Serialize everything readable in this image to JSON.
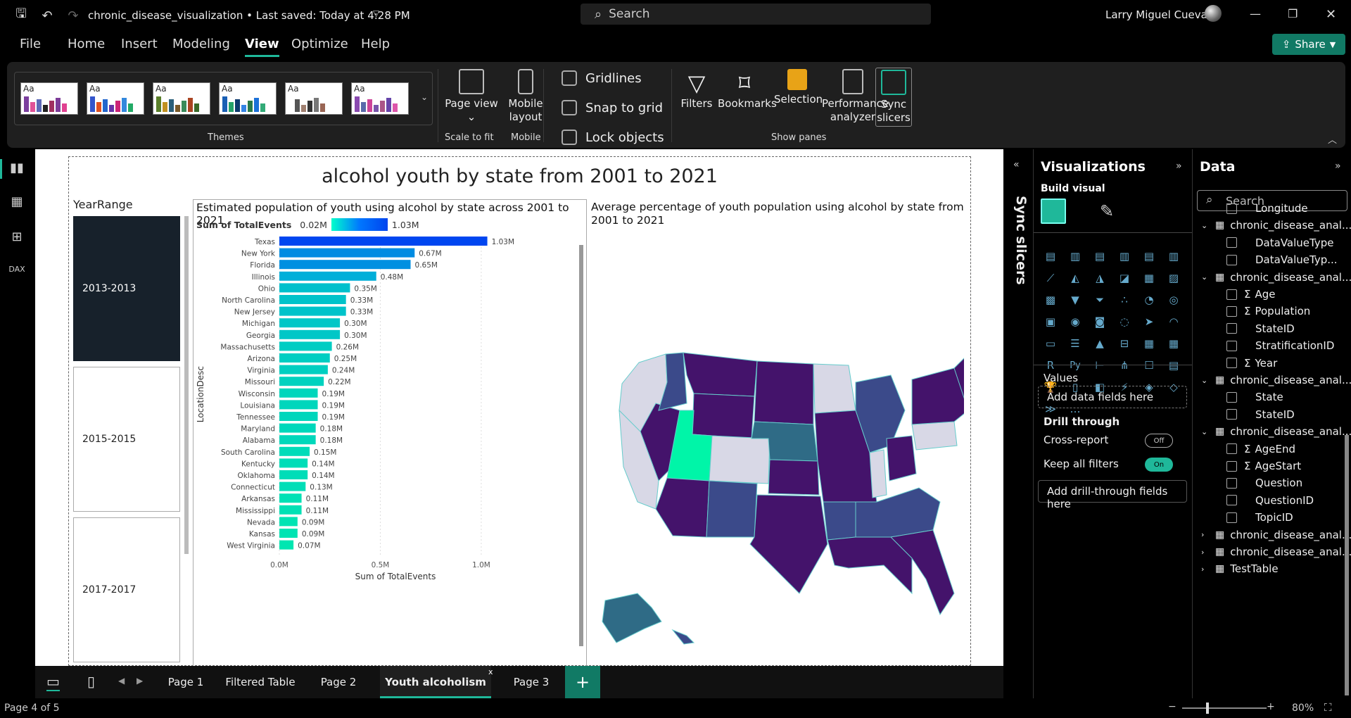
{
  "titlebar": {
    "doc_title": "chronic_disease_visualization • Last saved: Today at 4:28 PM",
    "search_placeholder": "Search",
    "user": "Larry Miguel Cueva"
  },
  "menu": [
    "File",
    "Home",
    "Insert",
    "Modeling",
    "View",
    "Optimize",
    "Help"
  ],
  "share_label": "Share",
  "ribbon": {
    "themes_label": "Themes",
    "page_view": "Page view",
    "scale_to_fit": "Scale to fit",
    "mobile_layout": "Mobile layout",
    "mobile": "Mobile",
    "gridlines": "Gridlines",
    "snap_to_grid": "Snap to grid",
    "lock_objects": "Lock objects",
    "filters": "Filters",
    "bookmarks": "Bookmarks",
    "selection": "Selection",
    "performance_analyzer": "Performance analyzer",
    "sync_slicers": "Sync slicers",
    "show_panes": "Show panes",
    "theme_aa": "Aa"
  },
  "report": {
    "title": "alcohol youth by state from 2001 to 2021",
    "slicer_title": "YearRange",
    "slicer_items": [
      "2013-2013",
      "2015-2015",
      "2017-2017"
    ],
    "bar_title": "Estimated population of youth using alcohol by state across 2001 to 2021",
    "legend_label": "Sum of TotalEvents",
    "legend_min": "0.02M",
    "legend_max": "1.03M",
    "y_axis_label": "LocationDesc",
    "x_axis_label": "Sum of TotalEvents",
    "map_title": "Average percentage of youth population using alcohol by state from 2001 to 2021"
  },
  "chart_data": {
    "type": "bar",
    "orientation": "horizontal",
    "categories": [
      "Texas",
      "New York",
      "Florida",
      "Illinois",
      "Ohio",
      "North Carolina",
      "New Jersey",
      "Michigan",
      "Georgia",
      "Massachusetts",
      "Arizona",
      "Virginia",
      "Missouri",
      "Wisconsin",
      "Louisiana",
      "Tennessee",
      "Maryland",
      "Alabama",
      "South Carolina",
      "Kentucky",
      "Oklahoma",
      "Connecticut",
      "Arkansas",
      "Mississippi",
      "Nevada",
      "Kansas",
      "West Virginia"
    ],
    "values": [
      1.03,
      0.67,
      0.65,
      0.48,
      0.35,
      0.33,
      0.33,
      0.3,
      0.3,
      0.26,
      0.25,
      0.24,
      0.22,
      0.19,
      0.19,
      0.19,
      0.18,
      0.18,
      0.15,
      0.14,
      0.14,
      0.13,
      0.11,
      0.11,
      0.09,
      0.09,
      0.07
    ],
    "labels": [
      "1.03M",
      "0.67M",
      "0.65M",
      "0.48M",
      "0.35M",
      "0.33M",
      "0.33M",
      "0.30M",
      "0.30M",
      "0.26M",
      "0.25M",
      "0.24M",
      "0.22M",
      "0.19M",
      "0.19M",
      "0.19M",
      "0.18M",
      "0.18M",
      "0.15M",
      "0.14M",
      "0.14M",
      "0.13M",
      "0.11M",
      "0.11M",
      "0.09M",
      "0.09M",
      "0.07M"
    ],
    "xticks": [
      "0.0M",
      "0.5M",
      "1.0M"
    ],
    "xlim": [
      0,
      1.15
    ],
    "xlabel": "Sum of TotalEvents",
    "ylabel": "LocationDesc"
  },
  "viz_pane": {
    "title": "Visualizations",
    "build_visual": "Build visual",
    "values": "Values",
    "add_data": "Add data fields here",
    "drill_through": "Drill through",
    "cross_report": "Cross-report",
    "cross_report_state": "Off",
    "keep_filters": "Keep all filters",
    "keep_filters_state": "On",
    "add_drill": "Add drill-through fields here",
    "sync_slicers": "Sync slicers"
  },
  "data_pane": {
    "title": "Data",
    "search_placeholder": "Search",
    "rows": [
      {
        "kind": "field",
        "label": "Longitude",
        "sigma": false
      },
      {
        "kind": "table",
        "label": "chronic_disease_anal...",
        "expanded": true
      },
      {
        "kind": "field",
        "label": "DataValueType",
        "sigma": false
      },
      {
        "kind": "field",
        "label": "DataValueTyp...",
        "sigma": false
      },
      {
        "kind": "table",
        "label": "chronic_disease_anal...",
        "expanded": true
      },
      {
        "kind": "field",
        "label": "Age",
        "sigma": true
      },
      {
        "kind": "field",
        "label": "Population",
        "sigma": true
      },
      {
        "kind": "field",
        "label": "StateID",
        "sigma": false
      },
      {
        "kind": "field",
        "label": "StratificationID",
        "sigma": false
      },
      {
        "kind": "field",
        "label": "Year",
        "sigma": true
      },
      {
        "kind": "table",
        "label": "chronic_disease_anal...",
        "expanded": true
      },
      {
        "kind": "field",
        "label": "State",
        "sigma": false
      },
      {
        "kind": "field",
        "label": "StateID",
        "sigma": false
      },
      {
        "kind": "table",
        "label": "chronic_disease_anal...",
        "expanded": true
      },
      {
        "kind": "field",
        "label": "AgeEnd",
        "sigma": true
      },
      {
        "kind": "field",
        "label": "AgeStart",
        "sigma": true
      },
      {
        "kind": "field",
        "label": "Question",
        "sigma": false
      },
      {
        "kind": "field",
        "label": "QuestionID",
        "sigma": false
      },
      {
        "kind": "field",
        "label": "TopicID",
        "sigma": false
      },
      {
        "kind": "table",
        "label": "chronic_disease_anal...",
        "expanded": false
      },
      {
        "kind": "table",
        "label": "chronic_disease_anal...",
        "expanded": false
      },
      {
        "kind": "table",
        "label": "TestTable",
        "expanded": false
      }
    ]
  },
  "tabs": [
    "Page 1",
    "Filtered Table",
    "Page 2",
    "Youth alcoholism",
    "Page 3"
  ],
  "active_tab": "Youth alcoholism",
  "status": {
    "page": "Page 4 of 5",
    "zoom": "80%"
  },
  "colors": {
    "accent": "#1fb89a",
    "share": "#117a65",
    "map_dark": "#44136b",
    "map_light": "#d8d8e6",
    "map_mid": "#3b4a8a",
    "map_teal": "#2f6b86",
    "map_highlight": "#00f5a8"
  }
}
